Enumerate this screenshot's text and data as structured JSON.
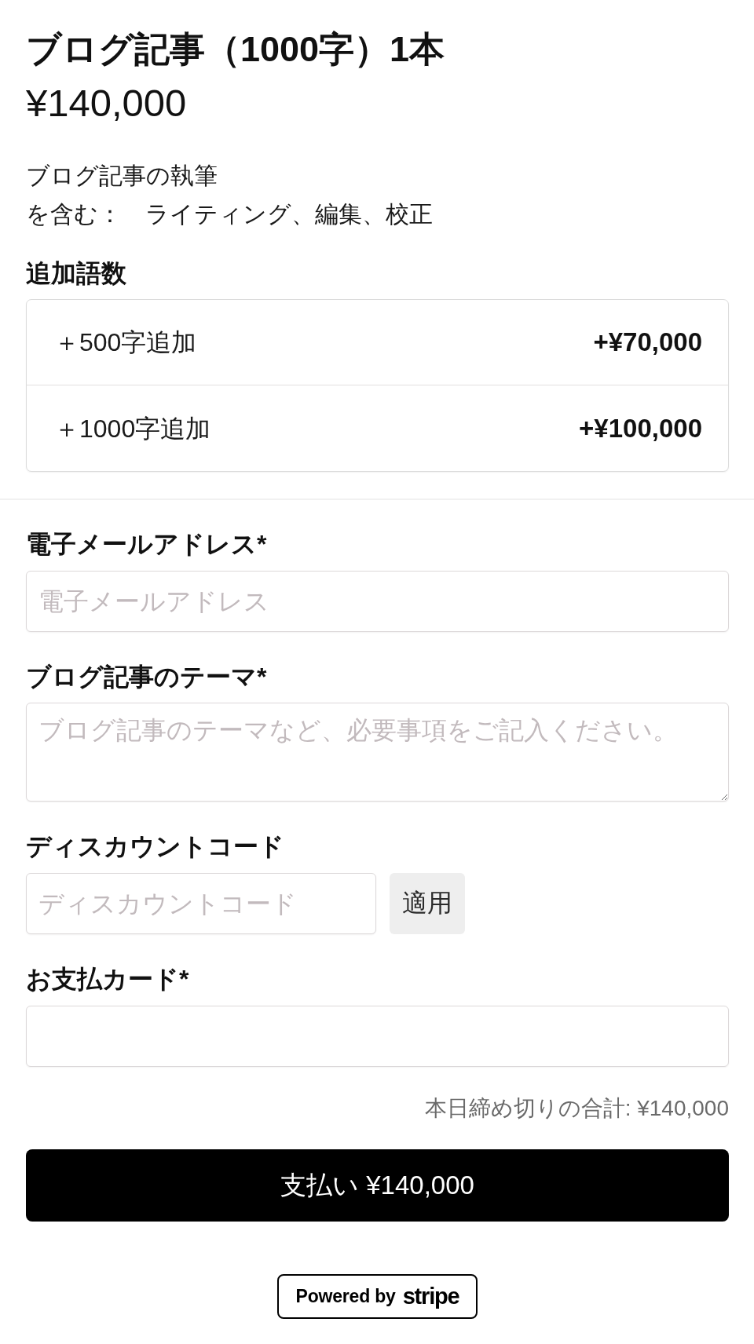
{
  "product": {
    "title": "ブログ記事（1000字）1本",
    "price": "¥140,000",
    "description_lines": [
      "ブログ記事の執筆",
      "を含む：　ライティング、編集、校正"
    ]
  },
  "addons": {
    "heading": "追加語数",
    "items": [
      {
        "label": "＋500字追加",
        "price": "+¥70,000"
      },
      {
        "label": "＋1000字追加",
        "price": "+¥100,000"
      }
    ]
  },
  "form": {
    "fields": [
      {
        "kind": "email",
        "label": "電子メールアドレス*",
        "placeholder": "電子メールアドレス"
      },
      {
        "kind": "textarea",
        "label": "ブログ記事のテーマ*",
        "placeholder": "ブログ記事のテーマなど、必要事項をご記入ください。"
      },
      {
        "kind": "coupon",
        "label": "ディスカウントコード",
        "placeholder": "ディスカウントコード",
        "button": "適用"
      },
      {
        "kind": "card",
        "label": "お支払カード*"
      }
    ]
  },
  "total": "本日締め切りの合計: ¥140,000",
  "pay_button": "支払い ¥140,000",
  "powered_by": {
    "label": "Powered by",
    "brand": "stripe"
  }
}
